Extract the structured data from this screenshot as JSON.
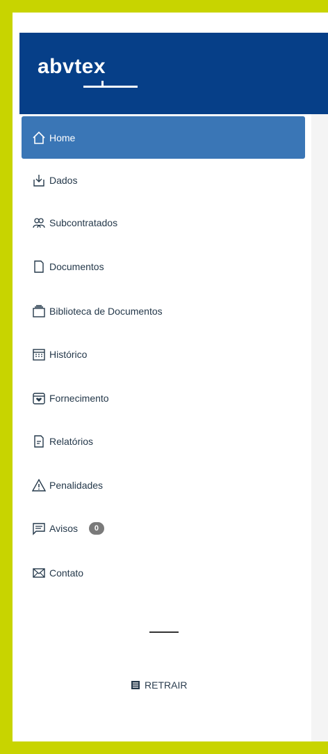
{
  "brand": {
    "logo_text": "abvtex"
  },
  "sidebar": {
    "items": [
      {
        "label": "Home",
        "icon": "home-icon",
        "active": true
      },
      {
        "label": "Dados",
        "icon": "download-icon",
        "active": false
      },
      {
        "label": "Subcontratados",
        "icon": "users-icon",
        "active": false
      },
      {
        "label": "Documentos",
        "icon": "document-icon",
        "active": false
      },
      {
        "label": "Biblioteca de Documentos",
        "icon": "library-icon",
        "active": false
      },
      {
        "label": "Histórico",
        "icon": "calendar-icon",
        "active": false
      },
      {
        "label": "Fornecimento",
        "icon": "box-icon",
        "active": false
      },
      {
        "label": "Relatórios",
        "icon": "report-icon",
        "active": false
      },
      {
        "label": "Penalidades",
        "icon": "warning-icon",
        "active": false
      },
      {
        "label": "Avisos",
        "icon": "message-icon",
        "active": false,
        "badge": "0"
      },
      {
        "label": "Contato",
        "icon": "envelope-icon",
        "active": false
      }
    ],
    "collapse_label": "RETRAIR"
  },
  "colors": {
    "frame": "#c8d400",
    "header": "#063f88",
    "active": "#3a76b6",
    "text": "#24384a"
  }
}
